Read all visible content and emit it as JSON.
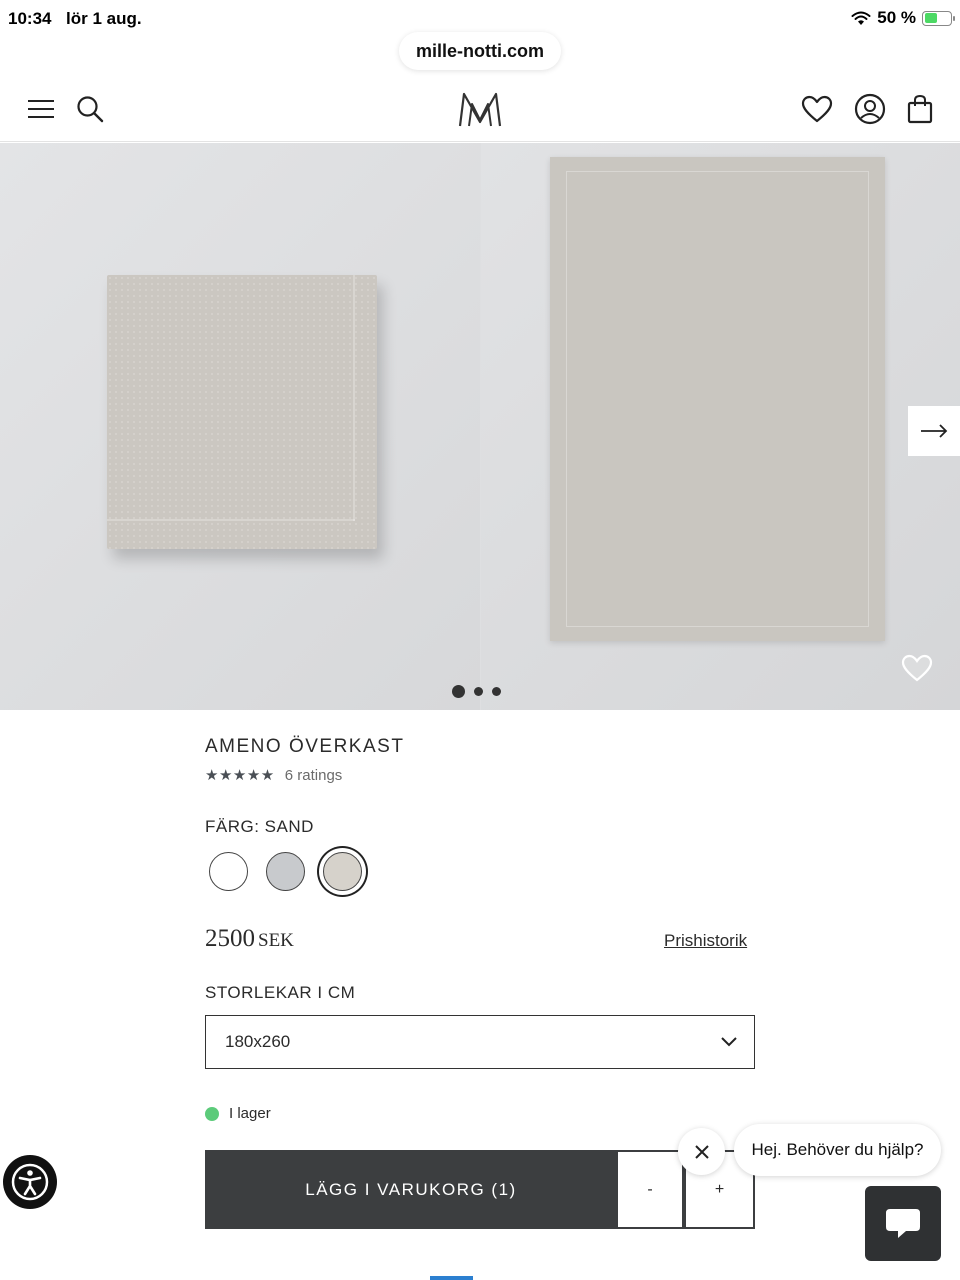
{
  "status_bar": {
    "time": "10:34",
    "date": "lör 1 aug.",
    "battery_percent": "50 %",
    "battery_level": 0.5
  },
  "browser": {
    "url": "mille-notti.com"
  },
  "header": {
    "icons": [
      "menu-icon",
      "search-icon",
      "brand-logo",
      "heart-icon",
      "account-icon",
      "shopping-bag-icon"
    ]
  },
  "gallery": {
    "slides_count": 3,
    "active_slide": 1
  },
  "product": {
    "title": "AMENO ÖVERKAST",
    "stars": "★★★★★",
    "rating_value": 5,
    "rating_count": "6 ratings",
    "color_label": "FÄRG: SAND",
    "swatches": [
      {
        "name": "white",
        "hex": "#ffffff",
        "selected": false
      },
      {
        "name": "grey",
        "hex": "#c8cacd",
        "selected": false
      },
      {
        "name": "sand",
        "hex": "#d6d2cb",
        "selected": true
      }
    ],
    "price_amount": "2500",
    "price_currency": "SEK",
    "price_history_link": "Prishistorik",
    "size_label": "STORLEKAR I CM",
    "size_selected": "180x260",
    "stock_status": "I lager",
    "stock_color": "#5ccb7a",
    "add_to_cart_label": "LÄGG I VARUKORG (1)",
    "qty_minus": "-",
    "qty_plus": "+"
  },
  "chat": {
    "greeting": "Hej. Behöver du hjälp?"
  },
  "colors": {
    "primary_button": "#3c3e40",
    "accent_blue": "#2b7fd0"
  }
}
